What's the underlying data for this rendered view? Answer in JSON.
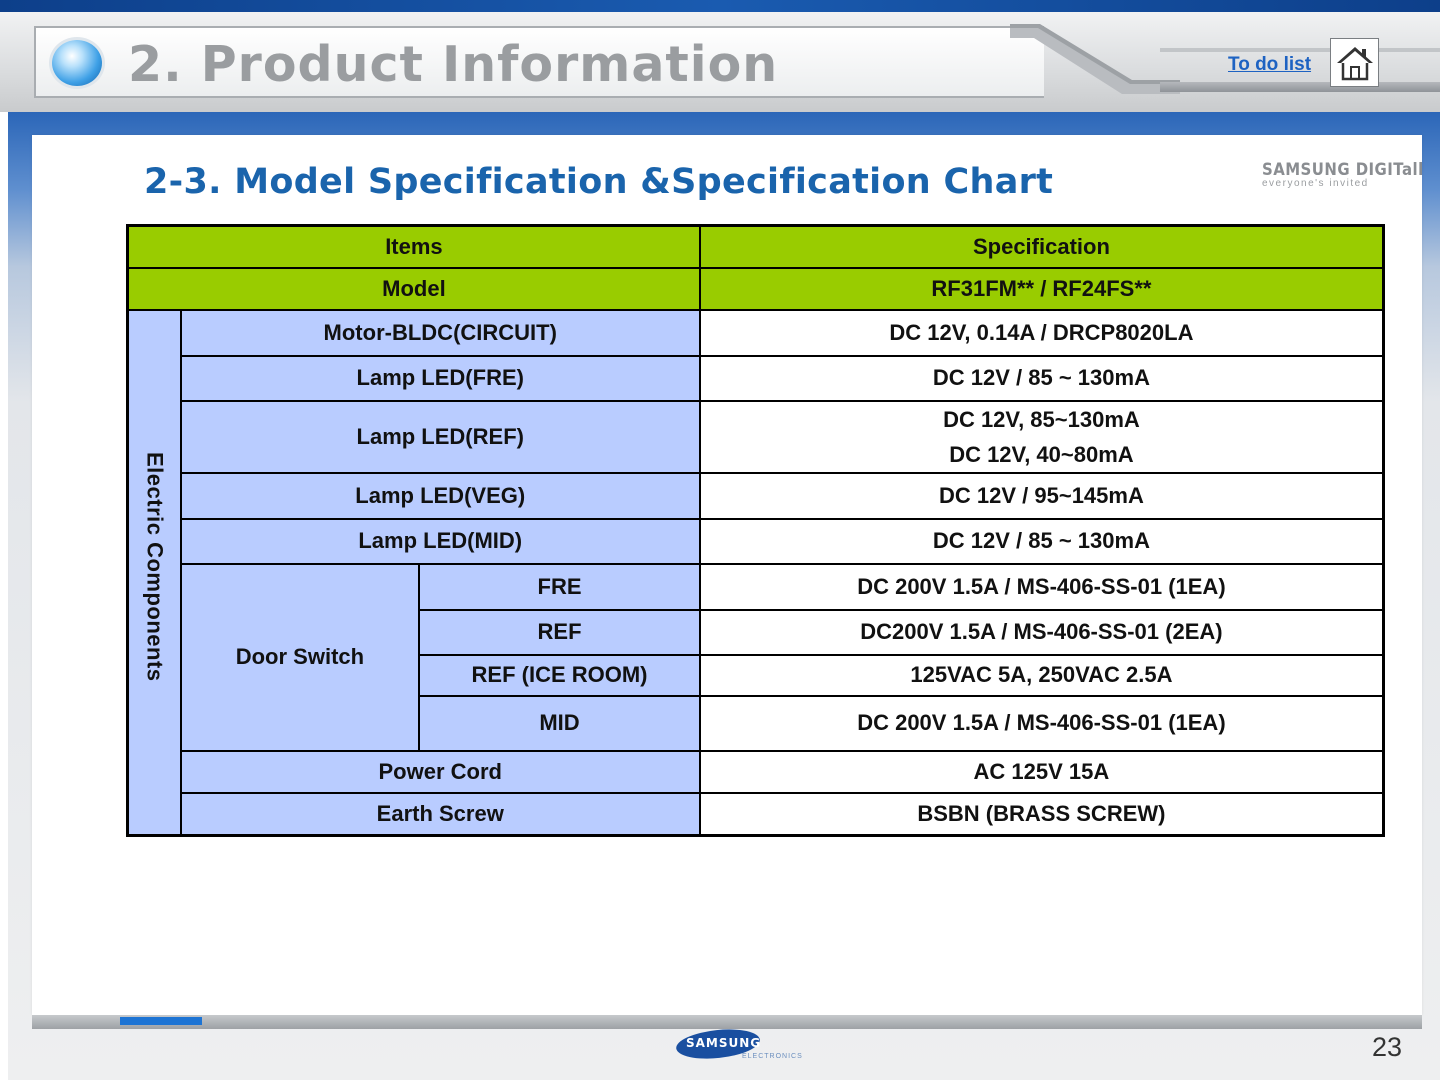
{
  "header": {
    "title": "2. Product Information",
    "todo_link": "To do list"
  },
  "section": {
    "title": "2-3. Model Specification &Specification Chart"
  },
  "brand": {
    "logo_text": "SAMSUNG DIGITall",
    "tagline": "everyone's invited"
  },
  "table": {
    "headers": {
      "items": "Items",
      "specification": "Specification"
    },
    "model": {
      "label": "Model",
      "value": "RF31FM** / RF24FS**"
    },
    "group_label": "Electric Components",
    "rows": [
      {
        "item": "Motor-BLDC(CIRCUIT)",
        "value": "DC 12V, 0.14A / DRCP8020LA"
      },
      {
        "item": "Lamp LED(FRE)",
        "value": "DC 12V / 85 ~ 130mA"
      },
      {
        "item": "Lamp LED(REF)",
        "value_lines": [
          "DC 12V, 85~130mA",
          "DC 12V, 40~80mA"
        ]
      },
      {
        "item": "Lamp LED(VEG)",
        "value": "DC 12V / 95~145mA"
      },
      {
        "item": "Lamp LED(MID)",
        "value": "DC 12V / 85 ~ 130mA"
      }
    ],
    "door_switch": {
      "label": "Door Switch",
      "rows": [
        {
          "item": "FRE",
          "value": "DC 200V 1.5A / MS-406-SS-01 (1EA)"
        },
        {
          "item": "REF",
          "value": "DC200V 1.5A / MS-406-SS-01 (2EA)"
        },
        {
          "item": "REF (ICE ROOM)",
          "value": "125VAC 5A, 250VAC 2.5A"
        },
        {
          "item": "MID",
          "value": "DC 200V 1.5A / MS-406-SS-01 (1EA)"
        }
      ]
    },
    "tail_rows": [
      {
        "item": "Power Cord",
        "value": "AC 125V 15A"
      },
      {
        "item": "Earth Screw",
        "value": "BSBN (BRASS SCREW)"
      }
    ]
  },
  "footer": {
    "logo_text": "SAMSUNG",
    "logo_sub": "ELECTRONICS",
    "page_number": "23"
  },
  "colors": {
    "header_green": "#99cc00",
    "item_blue": "#b9ccff",
    "title_blue": "#1a64ac",
    "link_blue": "#1d62c2"
  },
  "icons": {
    "home": "home-icon",
    "orb": "bullet-orb-icon"
  }
}
